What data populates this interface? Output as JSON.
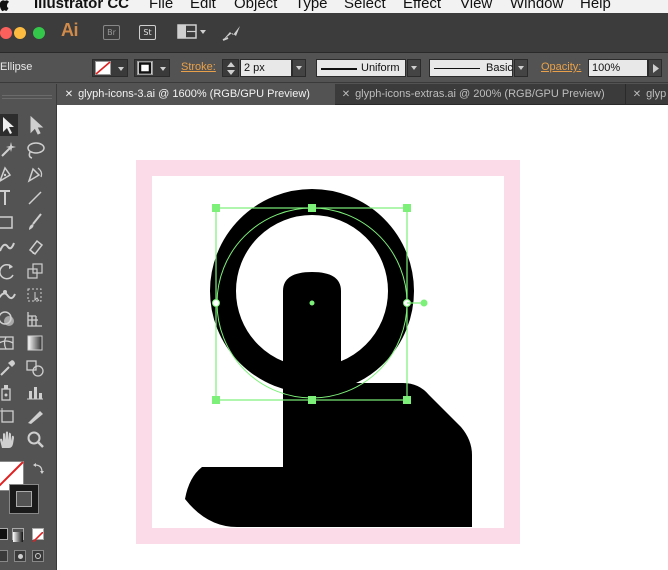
{
  "menubar": {
    "app_name": "Illustrator CC",
    "menus": [
      "File",
      "Edit",
      "Object",
      "Type",
      "Select",
      "Effect",
      "View",
      "Window",
      "Help"
    ]
  },
  "appbar": {
    "logo": "Ai",
    "bridge_label": "Br",
    "stock_label": "St"
  },
  "controlbar": {
    "selection_label": "Ellipse",
    "stroke_label": "Stroke:",
    "stroke_weight": "2 px",
    "stroke_profile": "Uniform",
    "brush": "Basic",
    "opacity_label": "Opacity:",
    "opacity_value": "100%"
  },
  "tabs": [
    {
      "label": "glyph-icons-3.ai @ 1600% (RGB/GPU Preview)",
      "active": true
    },
    {
      "label": "glyph-icons-extras.ai @ 200% (RGB/GPU Preview)",
      "active": false
    },
    {
      "label": "glyp",
      "active": false
    }
  ],
  "colors": {
    "pink_bleed": "#fbdbe7",
    "selection_green": "#7df07a",
    "accent_orange": "#e8a14a"
  }
}
